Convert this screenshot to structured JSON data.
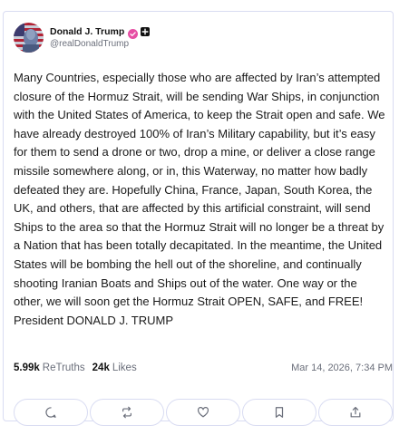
{
  "post": {
    "author": {
      "display_name": "Donald J. Trump",
      "handle": "@realDonaldTrump",
      "avatar_icon": "profile-photo-american-flag"
    },
    "text": "Many Countries, especially those who are affected by Iran’s attempted closure of the Hormuz Strait, will be sending War Ships, in conjunction with the United States of America, to keep the Strait open and safe. We have already destroyed 100% of Iran’s Military capability, but it’s easy for them to send a drone or two, drop a mine, or deliver a close range missile somewhere along, or in, this Waterway, no matter how badly defeated they are. Hopefully China, France, Japan, South Korea, the UK, and others, that are affected by this artificial constraint, will send Ships to the area so that the Hormuz Strait will no longer be a threat by a Nation that has been totally decapitated. In the meantime, the United States will be bombing the hell out of the shoreline, and continually shooting Iranian Boats and Ships out of the water. One way or the other, we will soon get the Hormuz Strait OPEN, SAFE, and FREE! President DONALD J. TRUMP",
    "stats": {
      "retruths_count": "5.99k",
      "retruths_label": "ReTruths",
      "likes_count": "24k",
      "likes_label": "Likes"
    },
    "timestamp": "Mar 14, 2026, 7:34 PM"
  },
  "actions": [
    {
      "icon": "reply-icon"
    },
    {
      "icon": "retruth-icon"
    },
    {
      "icon": "like-icon"
    },
    {
      "icon": "bookmark-icon"
    },
    {
      "icon": "share-icon"
    }
  ],
  "colors": {
    "verified_badge": "#e64fa4",
    "card_border": "#d9dcf2",
    "muted_text": "#6b6f7b",
    "icon_stroke": "#6b6f7b"
  }
}
